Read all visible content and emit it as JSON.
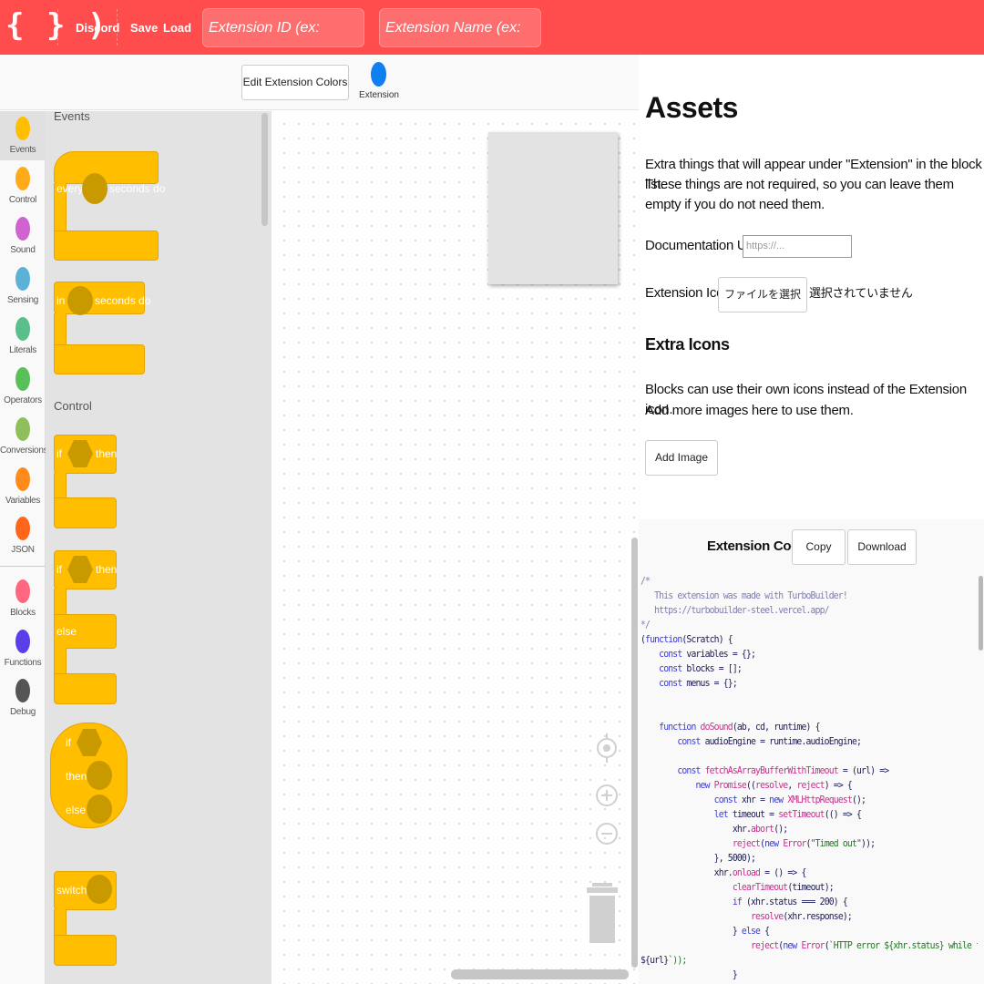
{
  "topbar": {
    "logo": "{ }  )",
    "discord": "Discord",
    "save": "Save",
    "load": "Load",
    "extension_id_placeholder": "Extension ID (ex: extensionID)",
    "extension_name_placeholder": "Extension Name (ex: Extension)",
    "color": "#ff4c4c"
  },
  "toolbar": {
    "edit_colors": "Edit Extension Colors",
    "extension_label": "Extension",
    "extension_color": "#0f7ff2"
  },
  "categories": [
    {
      "label": "Events",
      "color": "#ffbf00"
    },
    {
      "label": "Control",
      "color": "#ffab19"
    },
    {
      "label": "Sound",
      "color": "#cf63cf"
    },
    {
      "label": "Sensing",
      "color": "#5cb1d6"
    },
    {
      "label": "Literals",
      "color": "#59c08c"
    },
    {
      "label": "Operators",
      "color": "#59c059"
    },
    {
      "label": "Conversions",
      "color": "#8fbf5a"
    },
    {
      "label": "Variables",
      "color": "#ff8c1a"
    },
    {
      "label": "JSON",
      "color": "#ff661a"
    },
    {
      "label": "Blocks",
      "color": "#ff6680"
    },
    {
      "label": "Functions",
      "color": "#5a3ee8"
    },
    {
      "label": "Debug",
      "color": "#555555"
    }
  ],
  "flyout": {
    "events_heading": "Events",
    "control_heading": "Control",
    "every_block": {
      "word1": "every",
      "word2": "seconds do"
    },
    "in_block": {
      "word1": "in",
      "word2": "seconds do"
    },
    "if_then_block": {
      "word1": "if",
      "word2": "then"
    },
    "if_else_block": {
      "word1": "if",
      "word2": "then",
      "word3": "else"
    },
    "ternary_block": {
      "word1": "if",
      "word2": "then",
      "word3": "else"
    },
    "switch_block": {
      "word1": "switch"
    }
  },
  "assets": {
    "title": "Assets",
    "desc_line1": "Extra things that will appear under \"Extension\" in the block list.",
    "desc_line2": "These things are not required, so you can leave them empty if you do not need them.",
    "doc_url_label": "Documentation URL:",
    "doc_url_placeholder": "https://...",
    "icon_label": "Extension Icon:",
    "file_button": "ファイルを選択",
    "file_status": "選択されていません",
    "extra_icons_title": "Extra Icons",
    "extra_line1": "Blocks can use their own icons instead of the Extension icon.",
    "extra_line2": "Add more images here to use them.",
    "add_image": "Add Image"
  },
  "code": {
    "title": "Extension Code",
    "copy": "Copy",
    "download": "Download",
    "lines": [
      "/*",
      "   This extension was made with TurboBuilder!",
      "   https://turbobuilder-steel.vercel.app/",
      "*/",
      "(function(Scratch) {",
      "    const variables = {};",
      "    const blocks = [];",
      "    const menus = {};",
      "",
      "",
      "    function doSound(ab, cd, runtime) {",
      "        const audioEngine = runtime.audioEngine;",
      "",
      "        const fetchAsArrayBufferWithTimeout = (url) =>",
      "            new Promise((resolve, reject) => {",
      "                const xhr = new XMLHttpRequest();",
      "                let timeout = setTimeout(() => {",
      "                    xhr.abort();",
      "                    reject(new Error(\"Timed out\"));",
      "                }, 5000);",
      "                xhr.onload = () => {",
      "                    clearTimeout(timeout);",
      "                    if (xhr.status === 200) {",
      "                        resolve(xhr.response);",
      "                    } else {",
      "                        reject(new Error(`HTTP error ${xhr.status} while fetching",
      "${url}`));",
      "                    }",
      "                };"
    ]
  }
}
